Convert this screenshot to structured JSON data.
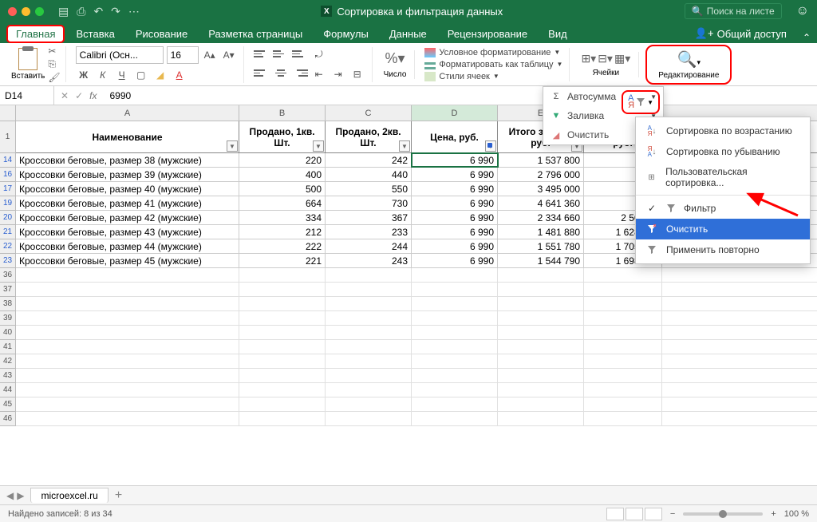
{
  "titlebar": {
    "doc_icon": "X",
    "title": "Сортировка и фильтрация данных",
    "search_placeholder": "Поиск на листе"
  },
  "tabs": {
    "home": "Главная",
    "insert": "Вставка",
    "draw": "Рисование",
    "layout": "Разметка страницы",
    "formulas": "Формулы",
    "data": "Данные",
    "review": "Рецензирование",
    "view": "Вид",
    "share": "Общий доступ"
  },
  "ribbon": {
    "paste": "Вставить",
    "font_name": "Calibri (Осн...",
    "font_size": "16",
    "bold": "Ж",
    "italic": "К",
    "underline": "Ч",
    "number_label": "Число",
    "cond_format": "Условное форматирование",
    "format_table": "Форматировать как таблицу",
    "cell_styles": "Стили ячеек",
    "cells_label": "Ячейки",
    "edit_label": "Редактирование"
  },
  "dd": {
    "autosum": "Автосумма",
    "fill": "Заливка",
    "clear": "Очистить",
    "sort_label": "С..."
  },
  "ctx": {
    "sort_asc": "Сортировка по возрастанию",
    "sort_desc": "Сортировка по убыванию",
    "custom_sort": "Пользовательская сортировка...",
    "filter": "Фильтр",
    "clear": "Очистить",
    "reapply": "Применить повторно"
  },
  "formula": {
    "cell_ref": "D14",
    "value": "6990"
  },
  "headers": {
    "name": "Наименование",
    "q1": "Продано, 1кв. Шт.",
    "q2": "Продано, 2кв. Шт.",
    "price": "Цена, руб.",
    "total1": "Итого за 1кв., руб.",
    "total2": "Итого за 2кв., руб."
  },
  "rows": [
    {
      "n": 14,
      "name": "Кроссовки беговые, размер 38 (мужские)",
      "q1": "220",
      "q2": "242",
      "price": "6 990",
      "t1": "1 537 800",
      "t2": "1 6"
    },
    {
      "n": 16,
      "name": "Кроссовки беговые, размер 39 (мужские)",
      "q1": "400",
      "q2": "440",
      "price": "6 990",
      "t1": "2 796 000",
      "t2": "3 0"
    },
    {
      "n": 17,
      "name": "Кроссовки беговые, размер 40 (мужские)",
      "q1": "500",
      "q2": "550",
      "price": "6 990",
      "t1": "3 495 000",
      "t2": "3 8"
    },
    {
      "n": 19,
      "name": "Кроссовки беговые, размер 41 (мужские)",
      "q1": "664",
      "q2": "730",
      "price": "6 990",
      "t1": "4 641 360",
      "t2": "5 1"
    },
    {
      "n": 20,
      "name": "Кроссовки беговые, размер 42 (мужские)",
      "q1": "334",
      "q2": "367",
      "price": "6 990",
      "t1": "2 334 660",
      "t2": "2 503 33"
    },
    {
      "n": 21,
      "name": "Кроссовки беговые, размер 43 (мужские)",
      "q1": "212",
      "q2": "233",
      "price": "6 990",
      "t1": "1 481 880",
      "t2": "1 628 670"
    },
    {
      "n": 22,
      "name": "Кроссовки беговые, размер 44 (мужские)",
      "q1": "222",
      "q2": "244",
      "price": "6 990",
      "t1": "1 551 780",
      "t2": "1 705 560"
    },
    {
      "n": 23,
      "name": "Кроссовки беговые, размер 45 (мужские)",
      "q1": "221",
      "q2": "243",
      "price": "6 990",
      "t1": "1 544 790",
      "t2": "1 698 570"
    }
  ],
  "empty_rows": [
    36,
    37,
    38,
    39,
    40,
    41,
    42,
    43,
    44,
    45,
    46
  ],
  "sheet_tab": "microexcel.ru",
  "status": {
    "found": "Найдено записей: 8 из 34",
    "zoom": "100 %"
  }
}
